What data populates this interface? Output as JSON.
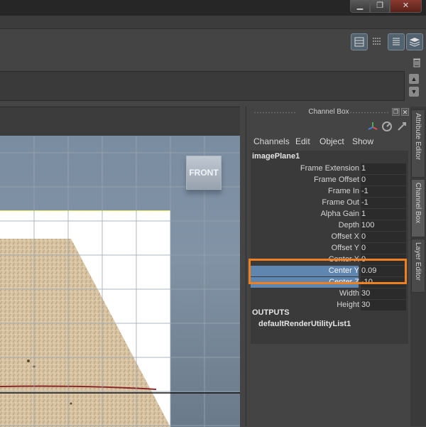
{
  "window": {
    "minimize_icon": "minimize-icon",
    "maximize_icon": "maximize-icon",
    "close_icon": "close-icon"
  },
  "toolbar_icons": [
    "channel-box-icon",
    "tool-settings-icon",
    "attribute-editor-icon",
    "layer-editor-icon"
  ],
  "viewport": {
    "view_cube_label": "FRONT"
  },
  "channel_box": {
    "title": "Channel Box",
    "menus": [
      "Channels",
      "Edit",
      "Object",
      "Show"
    ],
    "node_name": "imagePlane1",
    "attributes": [
      {
        "label": "Frame Extension",
        "value": "1"
      },
      {
        "label": "Frame Offset",
        "value": "0"
      },
      {
        "label": "Frame In",
        "value": "-1"
      },
      {
        "label": "Frame Out",
        "value": "-1"
      },
      {
        "label": "Alpha Gain",
        "value": "1"
      },
      {
        "label": "Depth",
        "value": "100"
      },
      {
        "label": "Offset X",
        "value": "0"
      },
      {
        "label": "Offset Y",
        "value": "0"
      },
      {
        "label": "Center X",
        "value": "0"
      },
      {
        "label": "Center Y",
        "value": "0.09",
        "selected": true
      },
      {
        "label": "Center Z",
        "value": "-10",
        "selected": true
      },
      {
        "label": "Width",
        "value": "30"
      },
      {
        "label": "Height",
        "value": "30"
      }
    ],
    "outputs_header": "OUTPUTS",
    "output_item": "defaultRenderUtilityList1",
    "highlight_color": "#f07f20",
    "selection_color": "#5e86ae"
  },
  "side_tabs": [
    "Attribute Editor",
    "Channel Box",
    "Layer Editor"
  ]
}
